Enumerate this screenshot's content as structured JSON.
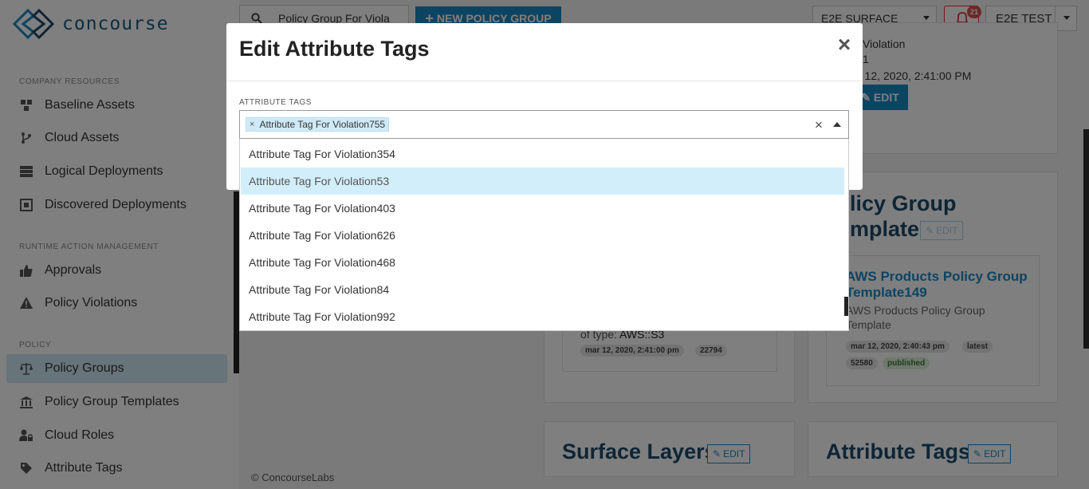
{
  "brand": {
    "name": "concourse"
  },
  "sidebar": {
    "sections": [
      {
        "label": "COMPANY RESOURCES"
      },
      {
        "label": "RUNTIME ACTION MANAGEMENT"
      },
      {
        "label": "POLICY"
      }
    ],
    "items": [
      {
        "label": "Baseline Assets",
        "icon": "cubes-icon"
      },
      {
        "label": "Cloud Assets",
        "icon": "branch-icon"
      },
      {
        "label": "Logical Deployments",
        "icon": "server-icon"
      },
      {
        "label": "Discovered Deployments",
        "icon": "scan-icon"
      },
      {
        "label": "Approvals",
        "icon": "thumbs-up-icon"
      },
      {
        "label": "Policy Violations",
        "icon": "warning-icon"
      },
      {
        "label": "Policy Groups",
        "icon": "balance-scale-icon",
        "active": true
      },
      {
        "label": "Policy Group Templates",
        "icon": "institution-icon"
      },
      {
        "label": "Cloud Roles",
        "icon": "user-lock-icon"
      },
      {
        "label": "Attribute Tags",
        "icon": "tag-icon"
      }
    ]
  },
  "topbar": {
    "search_value": "Policy Group For Viola",
    "new_button": "NEW POLICY GROUP",
    "surface_select": "E2E SURFACE",
    "notification_count": "21",
    "user_select": "E2E TEST"
  },
  "background": {
    "violation_text": "Violation",
    "violation_num": "1",
    "violation_date": "r 12, 2020, 2:41:00 PM",
    "edit_label": "EDIT",
    "template_card_title_1": "licy Group",
    "template_card_title_2": "mplate",
    "template_link_1": "AWS Products Policy Group",
    "template_link_2": "Template149",
    "template_desc_1": "AWS Products Policy Group",
    "template_desc_2": "Template",
    "template_tags": [
      "mar 12, 2020, 2:40:43 pm",
      "latest",
      "52580",
      "published"
    ],
    "left_card_type_prefix": "of type: ",
    "left_card_type": "AWS::S3",
    "left_card_tags": [
      "mar 12, 2020, 2:41:00 pm",
      "22794"
    ],
    "surface_layers_title": "Surface Layers",
    "attribute_tags_title": "Attribute Tags",
    "footer": "© ConcourseLabs"
  },
  "modal": {
    "title": "Edit Attribute Tags",
    "close_glyph": "×",
    "field_label": "ATTRIBUTE TAGS",
    "selected_tag": "Attribute Tag For Violation755",
    "chip_remove": "×",
    "clear_glyph": "×",
    "options": [
      "Attribute Tag For Violation354",
      "Attribute Tag For Violation53",
      "Attribute Tag For Violation403",
      "Attribute Tag For Violation626",
      "Attribute Tag For Violation468",
      "Attribute Tag For Violation84",
      "Attribute Tag For Violation992"
    ],
    "highlighted_index": 1
  },
  "colors": {
    "accent": "#1a89c5",
    "title_navy": "#1d4a6b",
    "active_nav": "#cfe8f5",
    "highlight_option": "#d2eefb",
    "badge_red": "#d9534f"
  }
}
